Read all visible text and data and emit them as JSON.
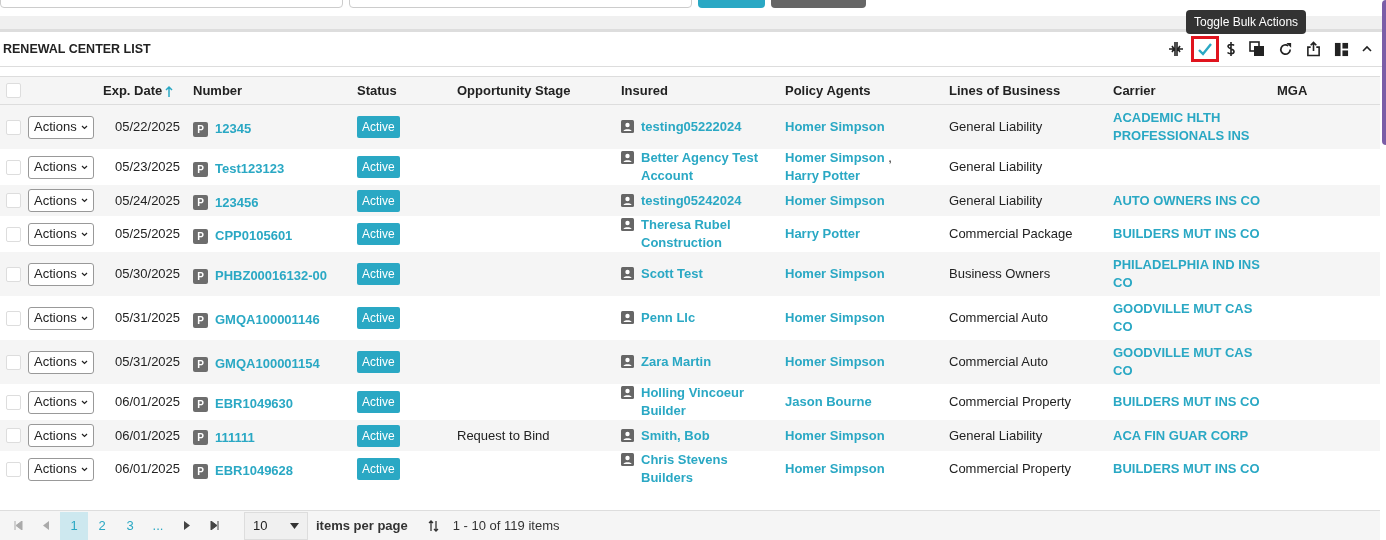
{
  "top_buttons": [
    {
      "kind": "primary"
    },
    {
      "kind": "secondary"
    }
  ],
  "panel": {
    "title": "RENEWAL CENTER LIST",
    "tooltip": "Toggle Bulk Actions"
  },
  "toolbar": [
    {
      "kind": "columns",
      "highlighted": false
    },
    {
      "kind": "check",
      "highlighted": true
    },
    {
      "kind": "dollar",
      "highlighted": false
    },
    {
      "kind": "copy",
      "highlighted": false
    },
    {
      "kind": "refresh",
      "highlighted": false
    },
    {
      "kind": "export",
      "highlighted": false
    },
    {
      "kind": "layout",
      "highlighted": false
    },
    {
      "kind": "collapse",
      "highlighted": false
    }
  ],
  "table": {
    "columns": [
      {
        "label": "Exp. Date",
        "sorted": true
      },
      {
        "label": "Number",
        "sorted": false
      },
      {
        "label": "Status",
        "sorted": false
      },
      {
        "label": "Opportunity Stage",
        "sorted": false
      },
      {
        "label": "Insured",
        "sorted": false
      },
      {
        "label": "Policy Agents",
        "sorted": false
      },
      {
        "label": "Lines of Business",
        "sorted": false
      },
      {
        "label": "Carrier",
        "sorted": false
      },
      {
        "label": "MGA",
        "sorted": false
      }
    ],
    "header_checked": false,
    "agent_separator": ",",
    "rows": [
      {
        "checked": false,
        "actions_label": "Actions",
        "exp_date": "05/22/2025",
        "badge": "P",
        "number": "12345",
        "status": "Active",
        "stage": "",
        "insured": "testing05222024",
        "agents": [
          "Homer Simpson"
        ],
        "lob": "General Liability",
        "carrier": "ACADEMIC HLTH PROFESSIONALS INS"
      },
      {
        "checked": false,
        "actions_label": "Actions",
        "exp_date": "05/23/2025",
        "badge": "P",
        "number": "Test123123",
        "status": "Active",
        "stage": "",
        "insured": "Better Agency Test Account",
        "agents": [
          "Homer Simpson",
          "Harry Potter"
        ],
        "lob": "General Liability",
        "carrier": ""
      },
      {
        "checked": false,
        "actions_label": "Actions",
        "exp_date": "05/24/2025",
        "badge": "P",
        "number": "123456",
        "status": "Active",
        "stage": "",
        "insured": "testing05242024",
        "agents": [
          "Homer Simpson"
        ],
        "lob": "General Liability",
        "carrier": "AUTO OWNERS INS CO"
      },
      {
        "checked": false,
        "actions_label": "Actions",
        "exp_date": "05/25/2025",
        "badge": "P",
        "number": "CPP0105601",
        "status": "Active",
        "stage": "",
        "insured": "Theresa Rubel Construction",
        "agents": [
          "Harry Potter"
        ],
        "lob": "Commercial Package",
        "carrier": "BUILDERS MUT INS CO"
      },
      {
        "checked": false,
        "actions_label": "Actions",
        "exp_date": "05/30/2025",
        "badge": "P",
        "number": "PHBZ00016132-00",
        "status": "Active",
        "stage": "",
        "insured": "Scott Test",
        "agents": [
          "Homer Simpson"
        ],
        "lob": "Business Owners",
        "carrier": "PHILADELPHIA IND INS CO"
      },
      {
        "checked": false,
        "actions_label": "Actions",
        "exp_date": "05/31/2025",
        "badge": "P",
        "number": "GMQA100001146",
        "status": "Active",
        "stage": "",
        "insured": "Penn Llc",
        "agents": [
          "Homer Simpson"
        ],
        "lob": "Commercial Auto",
        "carrier": "GOODVILLE MUT CAS CO"
      },
      {
        "checked": false,
        "actions_label": "Actions",
        "exp_date": "05/31/2025",
        "badge": "P",
        "number": "GMQA100001154",
        "status": "Active",
        "stage": "",
        "insured": "Zara Martin",
        "agents": [
          "Homer Simpson"
        ],
        "lob": "Commercial Auto",
        "carrier": "GOODVILLE MUT CAS CO"
      },
      {
        "checked": false,
        "actions_label": "Actions",
        "exp_date": "06/01/2025",
        "badge": "P",
        "number": "EBR1049630",
        "status": "Active",
        "stage": "",
        "insured": "Holling Vincoeur Builder",
        "agents": [
          "Jason Bourne"
        ],
        "lob": "Commercial Property",
        "carrier": "BUILDERS MUT INS CO"
      },
      {
        "checked": false,
        "actions_label": "Actions",
        "exp_date": "06/01/2025",
        "badge": "P",
        "number": "111111",
        "status": "Active",
        "stage": "Request to Bind",
        "insured": "Smith, Bob",
        "agents": [
          "Homer Simpson"
        ],
        "lob": "General Liability",
        "carrier": "ACA FIN GUAR CORP"
      },
      {
        "checked": false,
        "actions_label": "Actions",
        "exp_date": "06/01/2025",
        "badge": "P",
        "number": "EBR1049628",
        "status": "Active",
        "stage": "",
        "insured": "Chris Stevens Builders",
        "agents": [
          "Homer Simpson"
        ],
        "lob": "Commercial Property",
        "carrier": "BUILDERS MUT INS CO"
      }
    ]
  },
  "pager": {
    "pages": [
      {
        "label": "1",
        "selected": true
      },
      {
        "label": "2",
        "selected": false
      },
      {
        "label": "3",
        "selected": false
      },
      {
        "label": "...",
        "selected": false
      }
    ],
    "page_size": "10",
    "page_size_label": "items per page",
    "summary": "1 - 10 of 119 items"
  }
}
